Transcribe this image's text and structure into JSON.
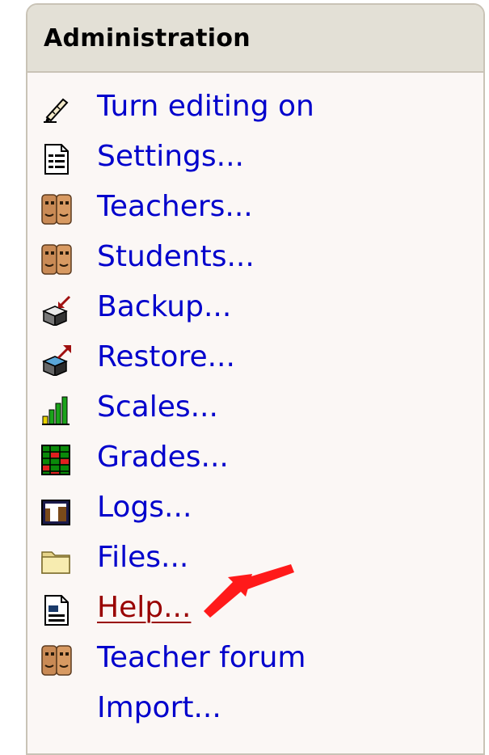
{
  "block": {
    "title": "Administration",
    "items": [
      {
        "label": "Turn editing on",
        "icon": "edit-pencil-icon"
      },
      {
        "label": "Settings...",
        "icon": "settings-document-icon"
      },
      {
        "label": "Teachers...",
        "icon": "users-faces-icon"
      },
      {
        "label": "Students...",
        "icon": "users-faces-icon"
      },
      {
        "label": "Backup...",
        "icon": "backup-icon"
      },
      {
        "label": "Restore...",
        "icon": "restore-icon"
      },
      {
        "label": "Scales...",
        "icon": "scales-bars-icon"
      },
      {
        "label": "Grades...",
        "icon": "grades-grid-icon"
      },
      {
        "label": "Logs...",
        "icon": "logs-chart-icon"
      },
      {
        "label": "Files...",
        "icon": "folder-icon"
      },
      {
        "label": "Help...",
        "icon": "help-document-icon"
      },
      {
        "label": "Teacher forum",
        "icon": "users-faces-icon"
      },
      {
        "label": "Import...",
        "icon": ""
      }
    ]
  },
  "annotation": {
    "icon": "red-arrow-pointer-icon",
    "color": "#ff1a1a"
  },
  "colors": {
    "link": "#0000cc",
    "visited_link": "#990000",
    "header_bg": "#e3e0d6",
    "block_bg": "#fbf7f5",
    "border": "#c9c3b6"
  }
}
